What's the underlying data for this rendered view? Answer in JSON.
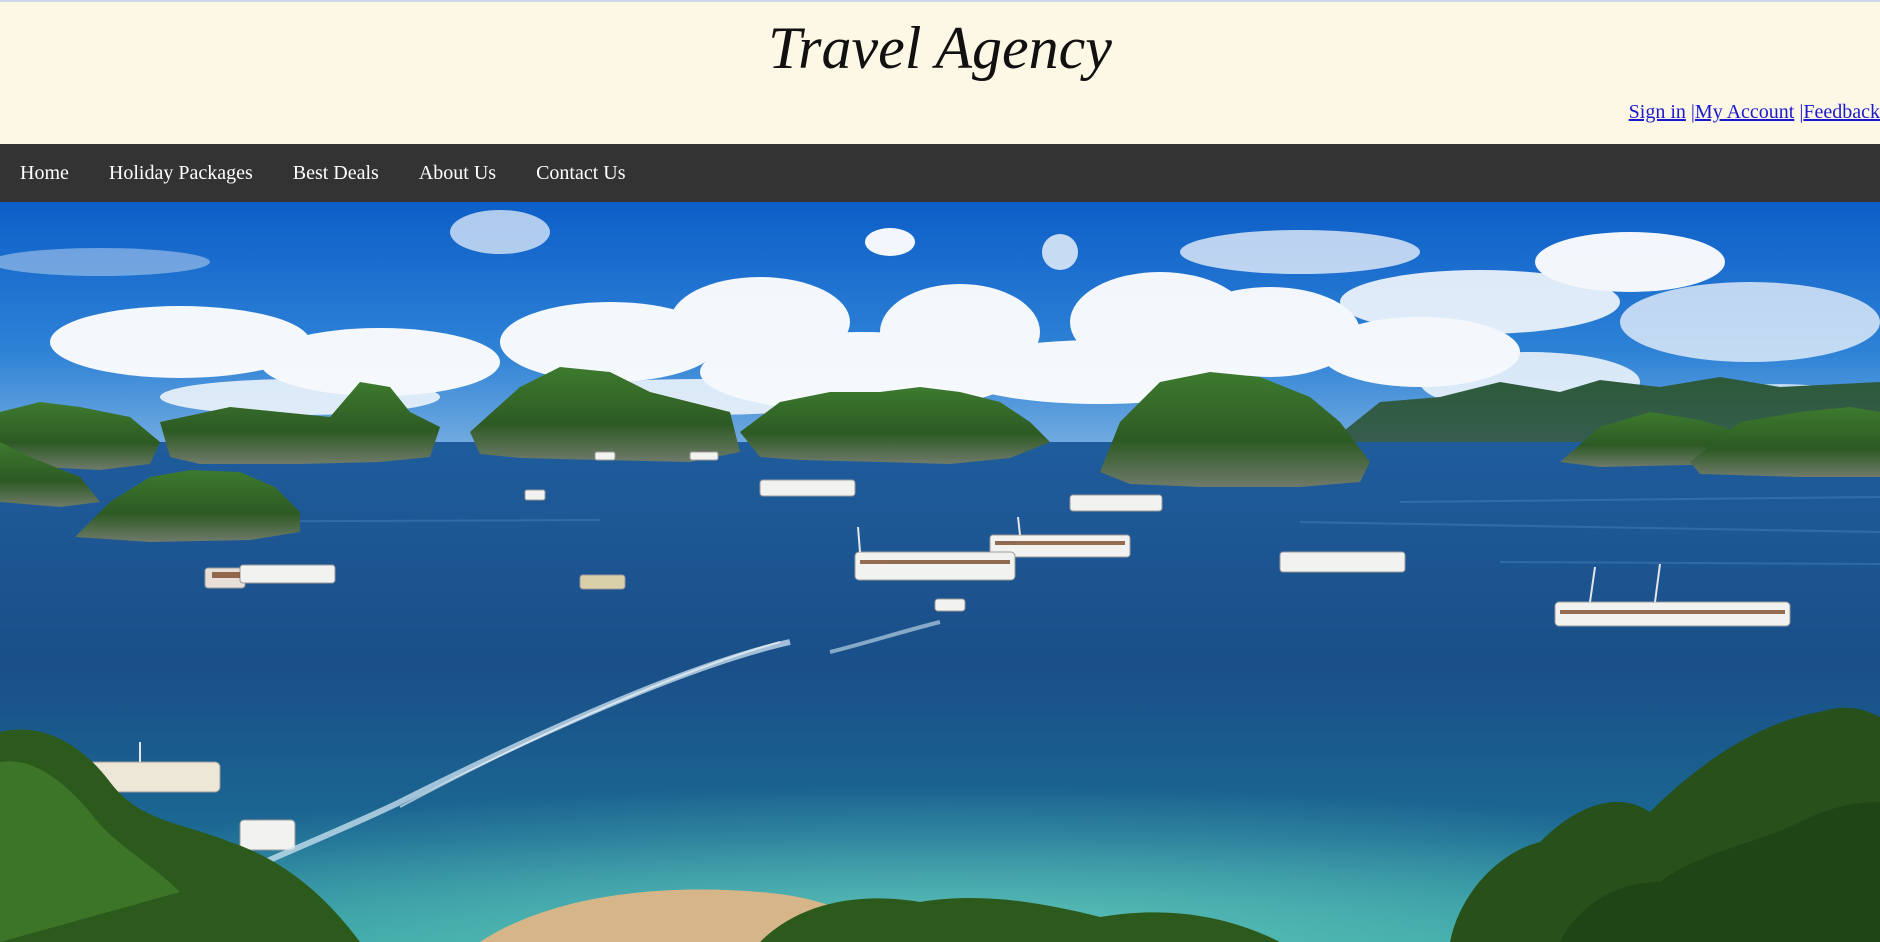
{
  "header": {
    "title": "Travel Agency",
    "account_links": [
      {
        "label": "Sign in"
      },
      {
        "label": "My Account"
      },
      {
        "label": "Feedback"
      }
    ],
    "separator": "|"
  },
  "nav": {
    "items": [
      {
        "label": "Home"
      },
      {
        "label": "Holiday Packages"
      },
      {
        "label": "Best Deals"
      },
      {
        "label": "About Us"
      },
      {
        "label": "Contact Us"
      }
    ]
  },
  "hero": {
    "image": "bay-with-islands-and-boats"
  },
  "colors": {
    "header_bg": "#fdf7e5",
    "nav_bg": "#333333",
    "link": "#1a1acc",
    "nav_text": "#ffffff"
  }
}
